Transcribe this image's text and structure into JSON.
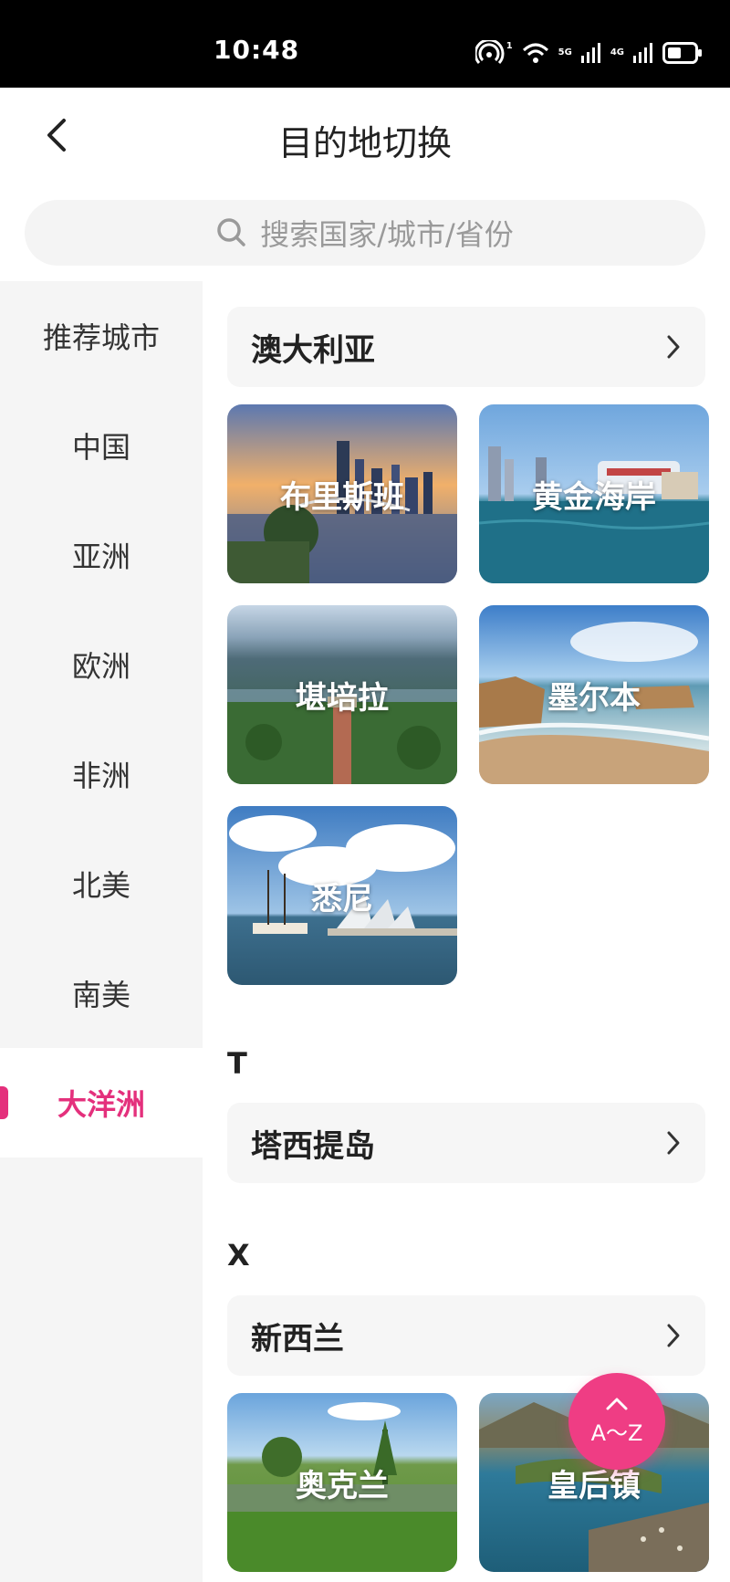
{
  "status_bar": {
    "time": "10:48",
    "network_5g": "5G",
    "network_4g": "4G",
    "hotspot_count": "1",
    "icons": [
      "hotspot-icon",
      "wifi-icon",
      "signal-5g-icon",
      "signal-4g-icon",
      "battery-icon"
    ]
  },
  "header": {
    "title": "目的地切换",
    "back_icon": "chevron-left-icon"
  },
  "search": {
    "placeholder": "搜索国家/城市/省份",
    "icon": "search-icon"
  },
  "sidebar": {
    "items": [
      {
        "label": "推荐城市",
        "active": false
      },
      {
        "label": "中国",
        "active": false
      },
      {
        "label": "亚洲",
        "active": false
      },
      {
        "label": "欧洲",
        "active": false
      },
      {
        "label": "非洲",
        "active": false
      },
      {
        "label": "北美",
        "active": false
      },
      {
        "label": "南美",
        "active": false
      },
      {
        "label": "大洋洲",
        "active": true
      }
    ]
  },
  "content": {
    "sections": [
      {
        "letter": "",
        "country": "澳大利亚",
        "cities": [
          "布里斯班",
          "黄金海岸",
          "堪培拉",
          "墨尔本",
          "悉尼"
        ]
      },
      {
        "letter": "T",
        "country": "塔西提岛",
        "cities": []
      },
      {
        "letter": "X",
        "country": "新西兰",
        "cities": [
          "奥克兰",
          "皇后镇"
        ]
      }
    ]
  },
  "fab": {
    "label": "A～Z",
    "icon": "chevron-up-icon"
  },
  "colors": {
    "accent": "#e4307c",
    "fab": "#ef3d84",
    "sidebar_bg": "#f5f5f5",
    "status_bar_bg": "#000000"
  }
}
